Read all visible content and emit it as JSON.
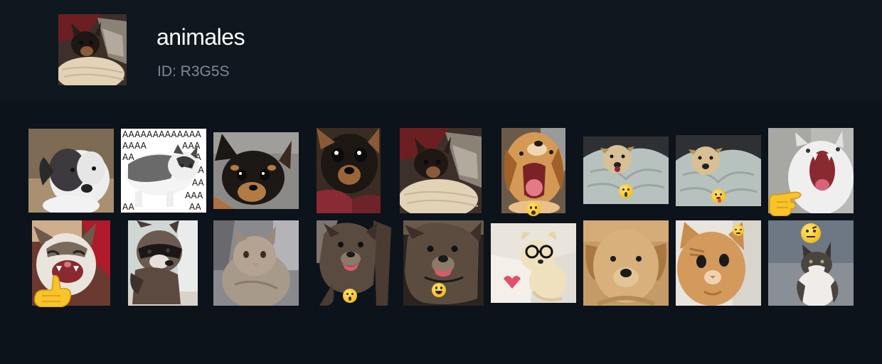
{
  "pack": {
    "title": "animales",
    "id_text": "ID: R3G5S"
  },
  "stickers": [
    {
      "name": "sticker-puppy-white",
      "subject": "dog",
      "emoji": ""
    },
    {
      "name": "sticker-cat-aaaa",
      "subject": "cat",
      "emoji": ""
    },
    {
      "name": "sticker-chihuahua-black",
      "subject": "dog",
      "emoji": ""
    },
    {
      "name": "sticker-chihuahua-closeup",
      "subject": "dog",
      "emoji": ""
    },
    {
      "name": "sticker-chihuahua-pillow",
      "subject": "dog",
      "emoji": ""
    },
    {
      "name": "sticker-dog-screaming",
      "subject": "dog",
      "emoji": "fearful-face-emoji"
    },
    {
      "name": "sticker-puppy-blanket",
      "subject": "dog",
      "emoji": "screaming-face-emoji"
    },
    {
      "name": "sticker-puppy-blanket-tongue",
      "subject": "dog",
      "emoji": "tongue-face-emoji"
    },
    {
      "name": "sticker-cat-yelling-pointing",
      "subject": "cat",
      "emoji": "pointing-hand-emoji"
    },
    {
      "name": "sticker-kitten-laughing-pointing",
      "subject": "cat",
      "emoji": "pointing-hand-emoji"
    },
    {
      "name": "sticker-raccoon",
      "subject": "raccoon",
      "emoji": ""
    },
    {
      "name": "sticker-cat-grey",
      "subject": "cat",
      "emoji": ""
    },
    {
      "name": "sticker-dog-brindle-1",
      "subject": "dog",
      "emoji": "surprised-face-emoji"
    },
    {
      "name": "sticker-dog-brindle-2",
      "subject": "dog",
      "emoji": "grinning-face-emoji"
    },
    {
      "name": "sticker-toy-dog-glasses",
      "subject": "toy",
      "emoji": ""
    },
    {
      "name": "sticker-labrador-puppy",
      "subject": "dog",
      "emoji": ""
    },
    {
      "name": "sticker-cat-orange-closeup",
      "subject": "cat",
      "emoji": "angry-face-emoji"
    },
    {
      "name": "sticker-cat-sitting",
      "subject": "cat",
      "emoji": "raised-eyebrow-face-emoji"
    }
  ]
}
